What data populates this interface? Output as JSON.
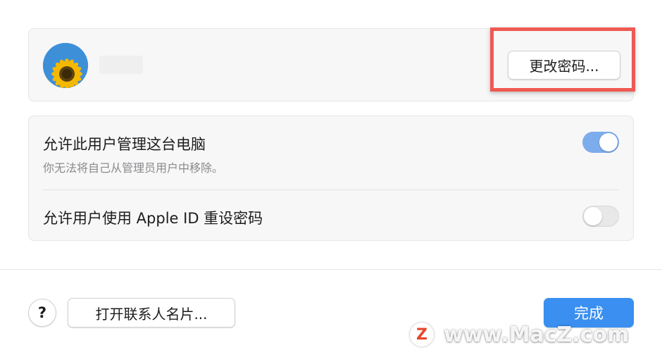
{
  "user_card": {
    "change_password_label": "更改密码..."
  },
  "settings": {
    "admin_title": "允许此用户管理这台电脑",
    "admin_subtitle": "你无法将自己从管理员用户中移除。",
    "admin_enabled": true,
    "appleid_title": "允许用户使用 Apple ID 重设密码",
    "appleid_enabled": false
  },
  "footer": {
    "help_label": "?",
    "contact_label": "打开联系人名片...",
    "done_label": "完成"
  },
  "watermark": {
    "logo_letter": "Z",
    "text": "www.MacZ.com"
  },
  "colors": {
    "accent": "#3a8ff0",
    "toggle_on": "#7cacec",
    "highlight": "#ee5a52"
  },
  "icons": {
    "avatar": "sunflower-avatar-icon",
    "help": "question-icon"
  }
}
